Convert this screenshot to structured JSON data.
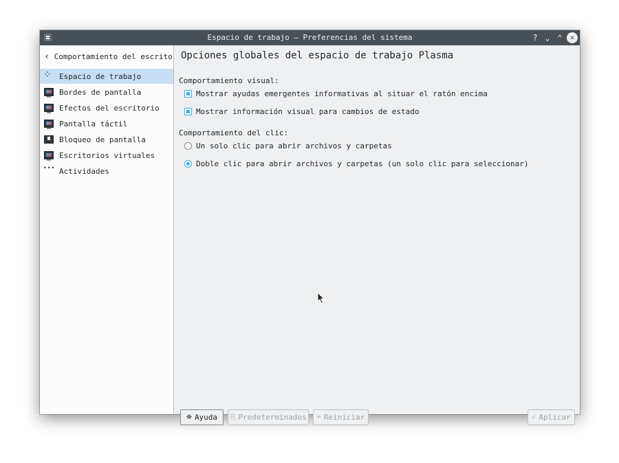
{
  "window": {
    "title": "Espacio de trabajo — Preferencias del sistema"
  },
  "titlebar_buttons": {
    "help": "?",
    "minimize": "⌄",
    "maximize": "⌃",
    "close": "✕"
  },
  "sidebar": {
    "back_label": "Comportamiento del escritor…",
    "items": [
      {
        "label": "Espacio de trabajo",
        "icon": "workspace-icon",
        "selected": true
      },
      {
        "label": "Bordes de pantalla",
        "icon": "screen-edges-icon"
      },
      {
        "label": "Efectos del escritorio",
        "icon": "desktop-effects-icon"
      },
      {
        "label": "Pantalla táctil",
        "icon": "touch-screen-icon"
      },
      {
        "label": "Bloqueo de pantalla",
        "icon": "screen-lock-icon"
      },
      {
        "label": "Escritorios virtuales",
        "icon": "virtual-desktops-icon"
      },
      {
        "label": "Actividades",
        "icon": "activities-icon"
      }
    ]
  },
  "main": {
    "title": "Opciones globales del espacio de trabajo Plasma",
    "visual_group": {
      "label": "Comportamiento visual:",
      "options": [
        {
          "label": "Mostrar ayudas emergentes informativas al situar el ratón encima",
          "checked": true
        },
        {
          "label": "Mostrar información visual para cambios de estado",
          "checked": true
        }
      ]
    },
    "click_group": {
      "label": "Comportamiento del clic:",
      "options": [
        {
          "label": "Un solo clic para abrir archivos y carpetas",
          "checked": false
        },
        {
          "label": "Doble clic para abrir archivos y carpetas (un solo clic para seleccionar)",
          "checked": true
        }
      ]
    }
  },
  "footer": {
    "help": "Ayuda",
    "defaults": "Predeterminados",
    "reset": "Reiniciar",
    "apply": "Aplicar"
  },
  "colors": {
    "accent": "#3daee9",
    "titlebar": "#475057",
    "selection": "#c6dff5",
    "window_bg": "#eff0f1"
  }
}
